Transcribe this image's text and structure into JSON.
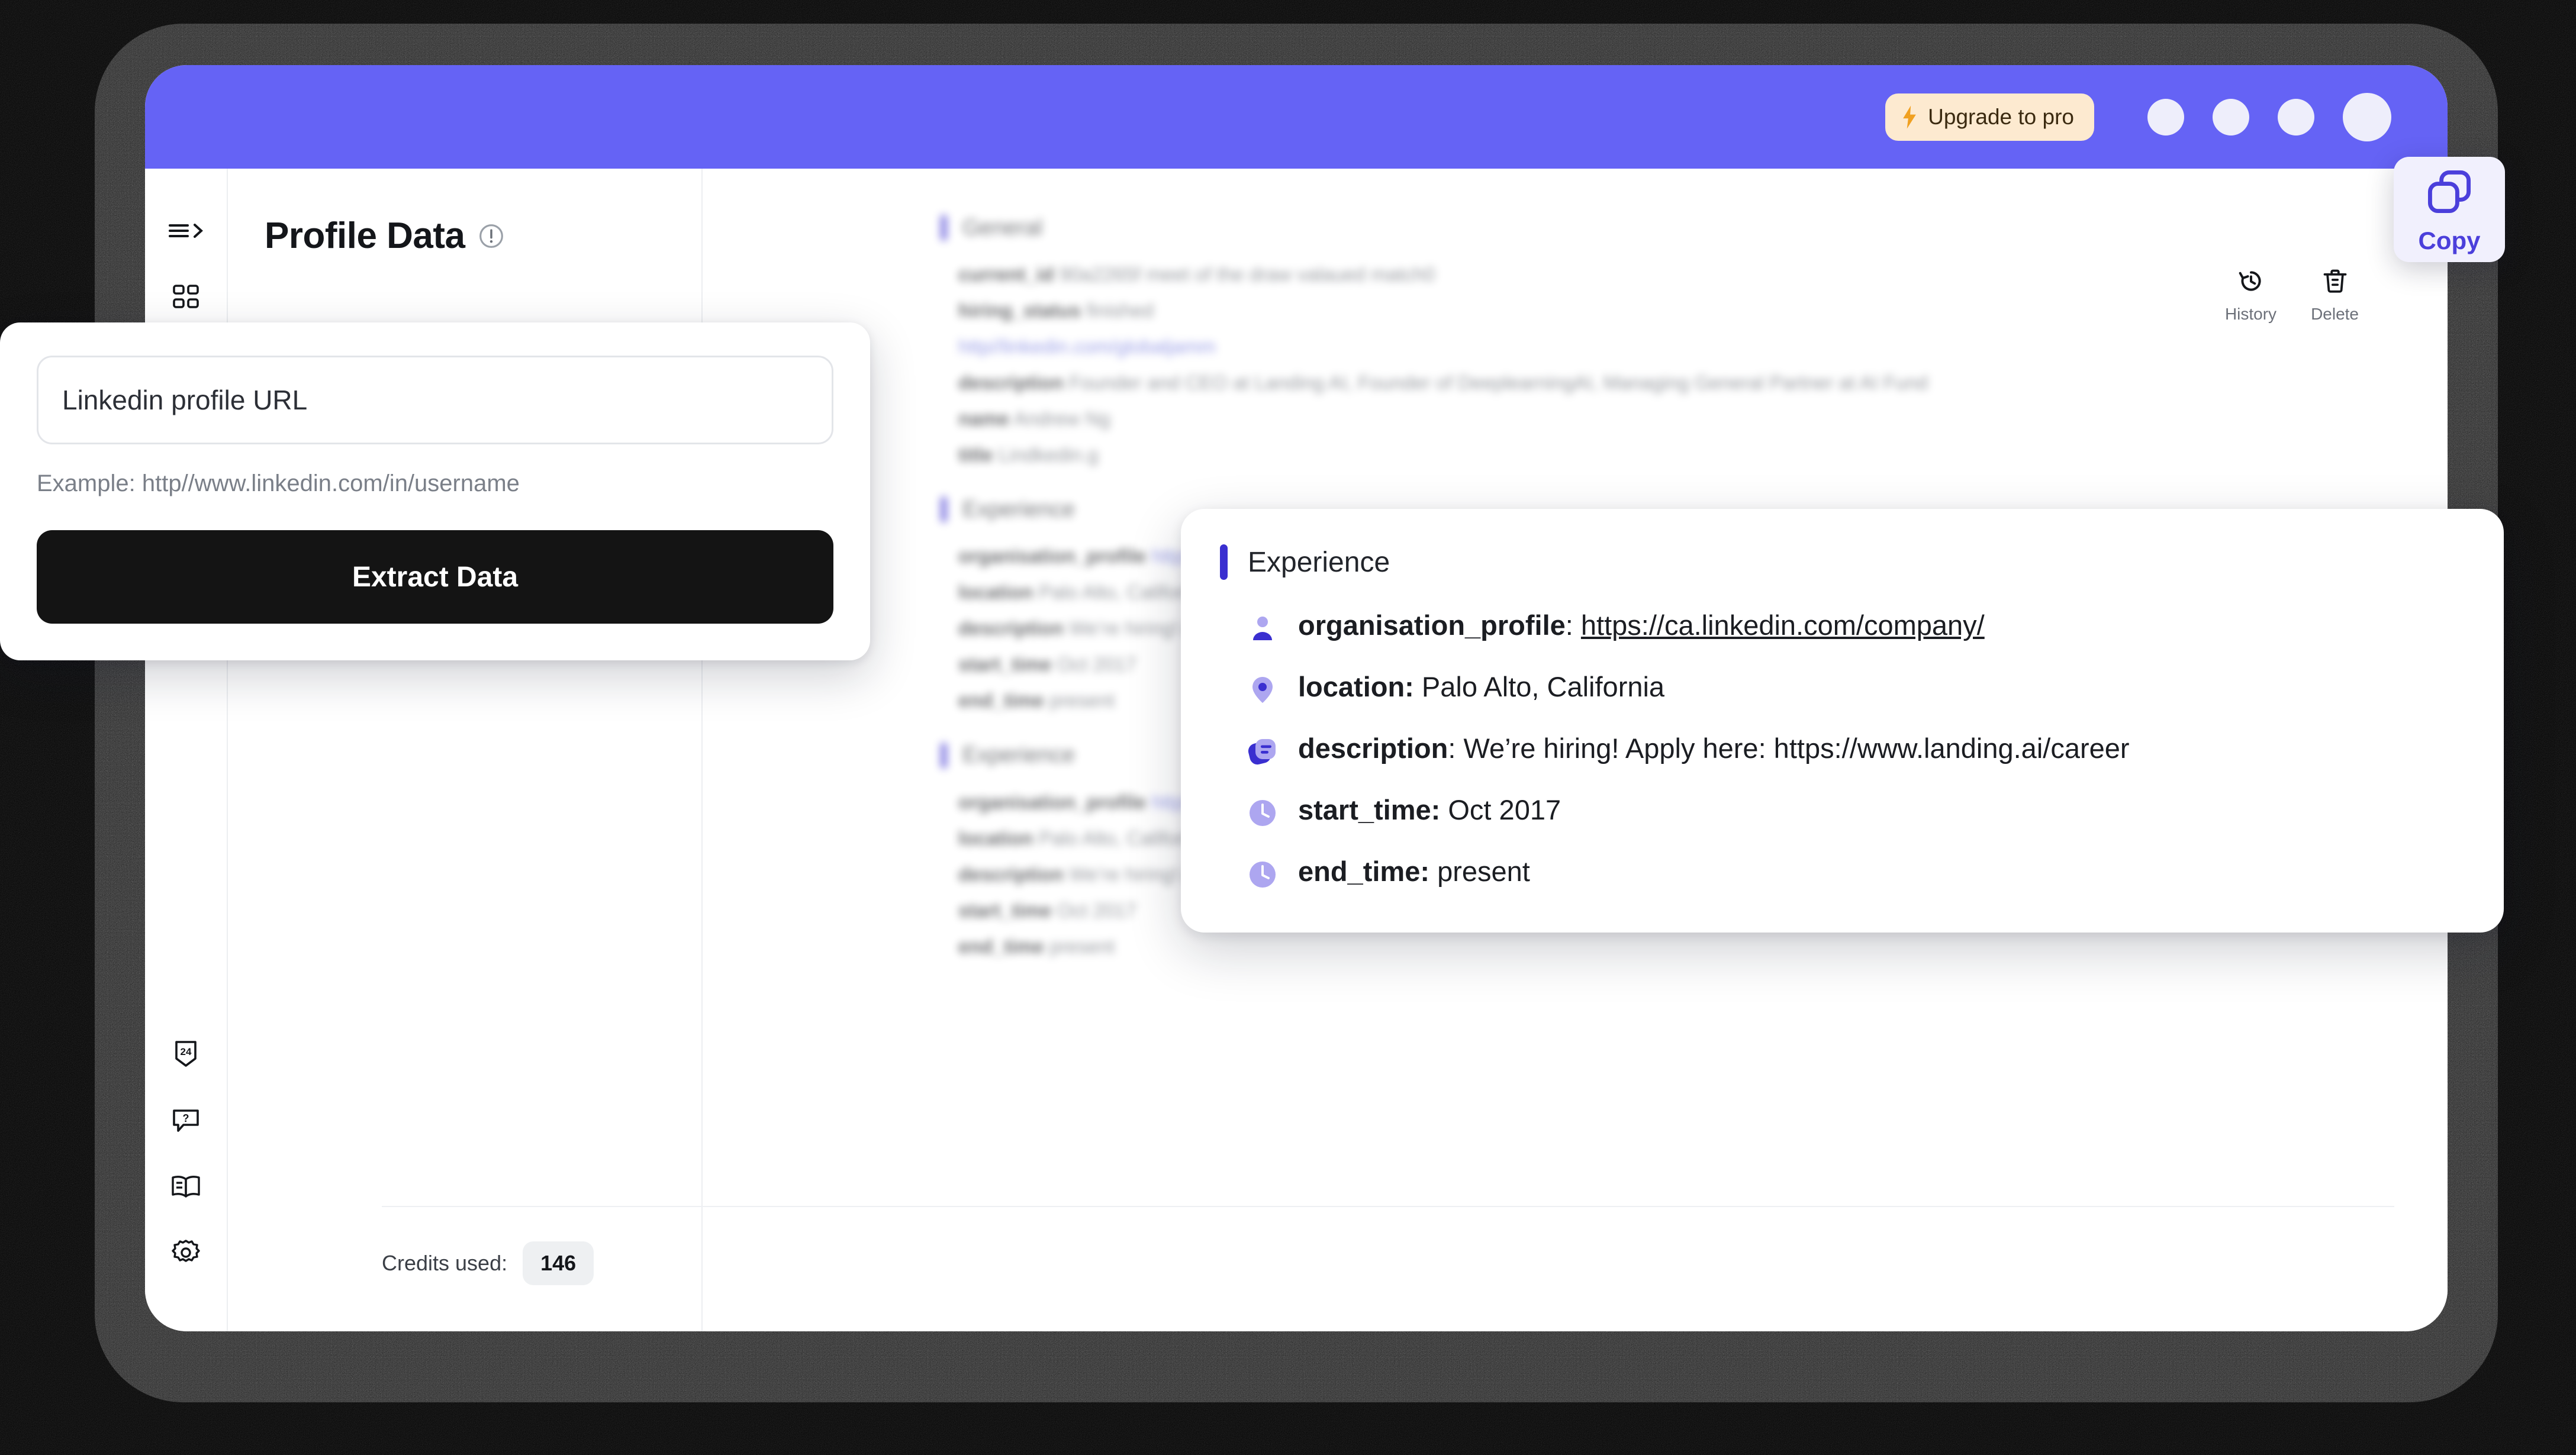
{
  "topbar": {
    "upgrade_label": "Upgrade to pro",
    "bolt_icon": "lightning-bolt-icon",
    "accent_color": "#6563f5",
    "pill_bg": "#fdead0"
  },
  "rail": {
    "items": [
      {
        "icon": "menu-expand-icon",
        "name": "menu-toggle"
      },
      {
        "icon": "grid-apps-icon",
        "name": "apps"
      },
      {
        "icon": "support-24-icon",
        "name": "support-24"
      },
      {
        "icon": "help-question-icon",
        "name": "help"
      },
      {
        "icon": "book-docs-icon",
        "name": "docs"
      },
      {
        "icon": "gear-settings-icon",
        "name": "settings"
      }
    ]
  },
  "left_panel": {
    "title": "Profile Data",
    "info_icon": "info-circle-icon"
  },
  "form_card": {
    "input_value": "Linkedin profile URL",
    "input_placeholder": "Linkedin profile URL",
    "hint": "Example: http//www.linkedin.com/in/username",
    "submit_label": "Extract Data"
  },
  "tools": [
    {
      "label": "History",
      "icon": "history-clock-icon"
    },
    {
      "label": "Delete",
      "icon": "trash-delete-icon"
    }
  ],
  "copy_button": {
    "label": "Copy",
    "icon": "copy-stacked-squares-icon",
    "color": "#4b3fdb",
    "bg": "#f1f0fd"
  },
  "experience_card": {
    "section_title": "Experience",
    "accent_color": "#3a2fd0",
    "rows": [
      {
        "icon": "person-profile-icon",
        "key": "organisation_profile",
        "separator": ": ",
        "value": "https://ca.linkedin.com/company/",
        "is_link": true
      },
      {
        "icon": "location-pin-icon",
        "key": "location:",
        "separator": " ",
        "value": "Palo Alto, California",
        "is_link": false
      },
      {
        "icon": "description-document-icon",
        "key": "description",
        "separator": ": ",
        "value": "We’re hiring! Apply here: https://www.landing.ai/career",
        "is_link": false
      },
      {
        "icon": "clock-start-icon",
        "key": "start_time:",
        "separator": " ",
        "value": "Oct 2017",
        "is_link": false
      },
      {
        "icon": "clock-end-icon",
        "key": "end_time:",
        "separator": " ",
        "value": "present",
        "is_link": false
      }
    ]
  },
  "background_content": {
    "general_section": "General",
    "general_rows": [
      {
        "key": "current_id",
        "value": "90a2265f meet of the draw valaued match0"
      },
      {
        "key": "hiring_status",
        "value": "finished"
      },
      {
        "key": "url",
        "value": "http//linkedin.com/globaljamm"
      },
      {
        "key": "description",
        "value": "Founder and CEO at Landing AI, Founder of DeeplearningAI, Managing General Partner at AI Fund"
      },
      {
        "key": "name",
        "value": "Andrew Ng"
      },
      {
        "key": "title",
        "value": "Lindkedin.g"
      }
    ],
    "experience_section": "Experience",
    "experience_rows": [
      {
        "key": "organisation_profile",
        "value": "https://ca.linkedin.com/company/"
      },
      {
        "key": "location",
        "value": "Palo Alto, California"
      },
      {
        "key": "description",
        "value": "We’re hiring! Apply here: https://www.landing.ai/career"
      },
      {
        "key": "start_time",
        "value": "Oct 2017"
      },
      {
        "key": "end_time",
        "value": "present"
      }
    ]
  },
  "footer": {
    "credits_label": "Credits used:",
    "credits_value": "146"
  }
}
